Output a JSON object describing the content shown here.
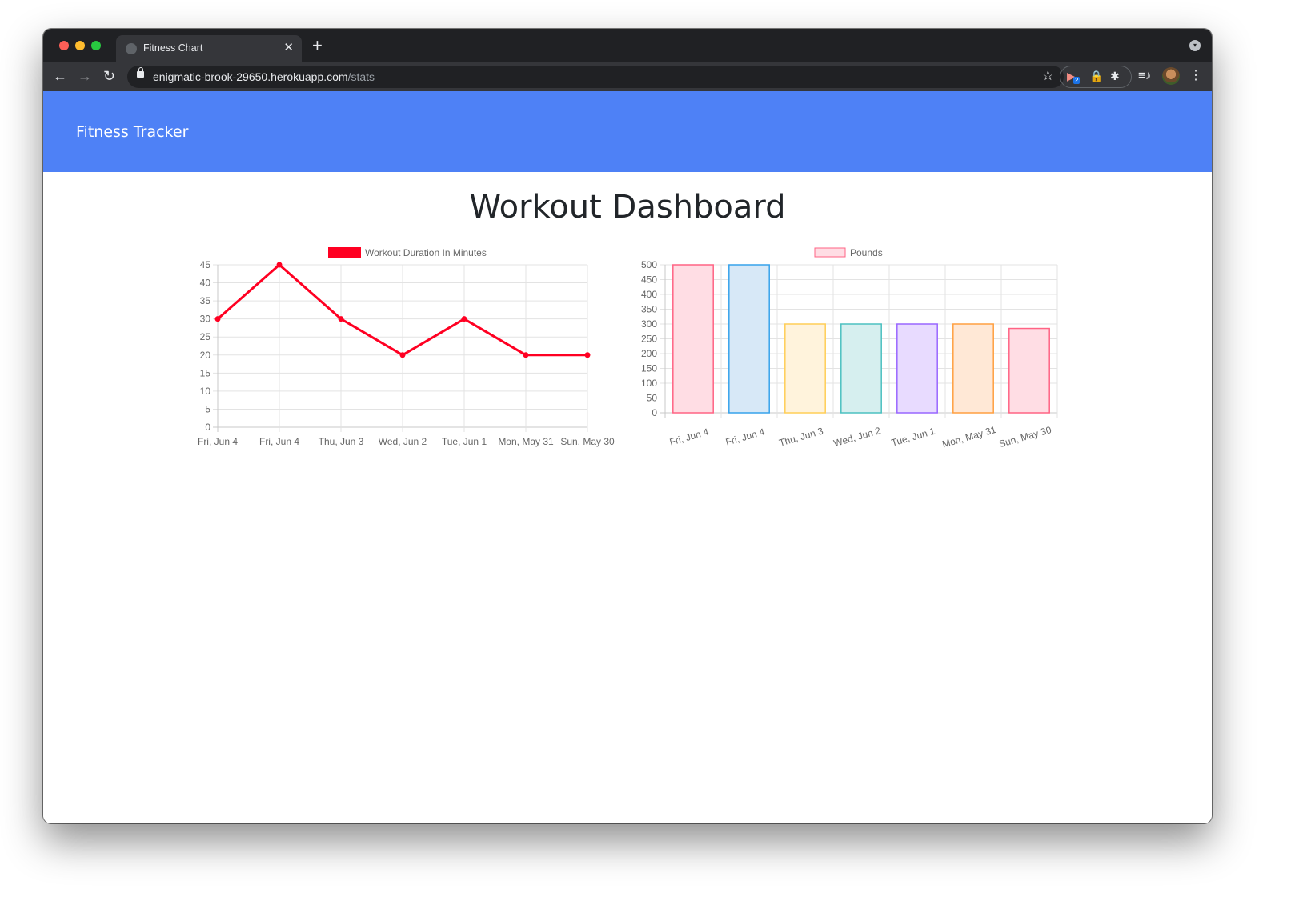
{
  "browser": {
    "tab_title": "Fitness Chart",
    "url_host": "enigmatic-brook-29650.herokuapp.com",
    "url_path": "/stats",
    "extension_badge": "2",
    "icons": {
      "back": "←",
      "forward": "→",
      "reload": "↻",
      "star": "☆",
      "close": "✕",
      "new_tab": "+",
      "puzzle": "✱",
      "lock_ext": "🔒",
      "media": "≡♪",
      "kebab": "⋮",
      "ext_play": "▶",
      "tab_menu": "▾"
    }
  },
  "navbar": {
    "brand": "Fitness Tracker",
    "color": "#4e81f6"
  },
  "page": {
    "title": "Workout Dashboard"
  },
  "chart_data": [
    {
      "type": "line",
      "title": "",
      "legend": [
        "Workout Duration In Minutes"
      ],
      "legend_position": "top",
      "categories": [
        "Fri, Jun 4",
        "Fri, Jun 4",
        "Thu, Jun 3",
        "Wed, Jun 2",
        "Tue, Jun 1",
        "Mon, May 31",
        "Sun, May 30"
      ],
      "series": [
        {
          "name": "Workout Duration In Minutes",
          "values": [
            30,
            45,
            30,
            20,
            30,
            20,
            20
          ],
          "color": "#ff0022"
        }
      ],
      "yticks": [
        "0",
        "5",
        "10",
        "15",
        "20",
        "25",
        "30",
        "35",
        "40",
        "45"
      ],
      "ylim": [
        0,
        45
      ],
      "xlabel": "",
      "ylabel": "",
      "grid": true
    },
    {
      "type": "bar",
      "title": "",
      "legend": [
        "Pounds"
      ],
      "legend_position": "top",
      "categories": [
        "Fri, Jun 4",
        "Fri, Jun 4",
        "Thu, Jun 3",
        "Wed, Jun 2",
        "Tue, Jun 1",
        "Mon, May 31",
        "Sun, May 30"
      ],
      "series": [
        {
          "name": "Pounds",
          "values": [
            500,
            500,
            300,
            300,
            300,
            300,
            285
          ]
        }
      ],
      "bar_colors": [
        {
          "fill": "#ffdde4",
          "stroke": "#ff6384"
        },
        {
          "fill": "#d7e8f7",
          "stroke": "#36a2eb"
        },
        {
          "fill": "#fff3dc",
          "stroke": "#ffce56"
        },
        {
          "fill": "#d6efef",
          "stroke": "#4bc0c0"
        },
        {
          "fill": "#e8dbff",
          "stroke": "#9966ff"
        },
        {
          "fill": "#ffe8d6",
          "stroke": "#ff9f40"
        },
        {
          "fill": "#ffdde4",
          "stroke": "#ff6384"
        }
      ],
      "yticks": [
        "0",
        "50",
        "100",
        "150",
        "200",
        "250",
        "300",
        "350",
        "400",
        "450",
        "500"
      ],
      "ylim": [
        0,
        500
      ],
      "xlabel": "",
      "ylabel": "",
      "grid": true
    }
  ]
}
